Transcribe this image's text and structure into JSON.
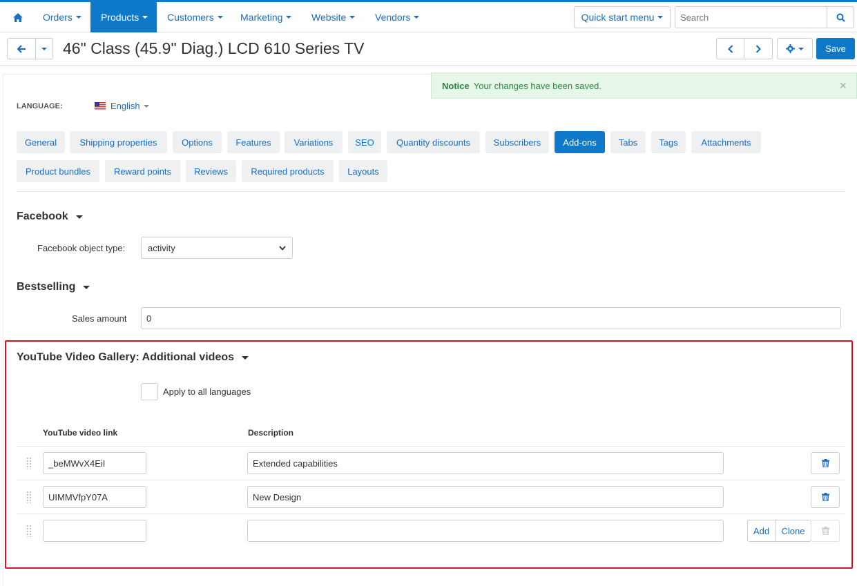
{
  "nav": {
    "home_icon": "home-icon",
    "items": [
      {
        "label": "Orders"
      },
      {
        "label": "Products"
      },
      {
        "label": "Customers"
      },
      {
        "label": "Marketing"
      },
      {
        "label": "Website"
      },
      {
        "label": "Vendors"
      }
    ],
    "quick_start": "Quick start menu",
    "search_placeholder": "Search"
  },
  "titlebar": {
    "title": "46\" Class (45.9\" Diag.) LCD 610 Series TV",
    "save_label": "Save"
  },
  "notice": {
    "title": "Notice",
    "message": "Your changes have been saved.",
    "close": "×"
  },
  "language": {
    "label": "LANGUAGE:",
    "value": "English"
  },
  "tabs": [
    {
      "label": "General"
    },
    {
      "label": "Shipping properties"
    },
    {
      "label": "Options"
    },
    {
      "label": "Features"
    },
    {
      "label": "Variations"
    },
    {
      "label": "SEO"
    },
    {
      "label": "Quantity discounts"
    },
    {
      "label": "Subscribers"
    },
    {
      "label": "Add-ons"
    },
    {
      "label": "Tabs"
    },
    {
      "label": "Tags"
    },
    {
      "label": "Attachments"
    },
    {
      "label": "Product bundles"
    },
    {
      "label": "Reward points"
    },
    {
      "label": "Reviews"
    },
    {
      "label": "Required products"
    },
    {
      "label": "Layouts"
    }
  ],
  "facebook": {
    "title": "Facebook",
    "field_label": "Facebook object type:",
    "value": "activity"
  },
  "bestselling": {
    "title": "Bestselling",
    "field_label": "Sales amount",
    "value": "0"
  },
  "youtube": {
    "title": "YouTube Video Gallery: Additional videos",
    "apply_all": "Apply to all languages",
    "col_link": "YouTube video link",
    "col_desc": "Description",
    "rows": [
      {
        "link": "_beMWvX4EiI",
        "desc": "Extended capabilities"
      },
      {
        "link": "UIMMVfpY07A",
        "desc": "New Design"
      },
      {
        "link": "",
        "desc": ""
      }
    ],
    "add_label": "Add",
    "clone_label": "Clone"
  }
}
